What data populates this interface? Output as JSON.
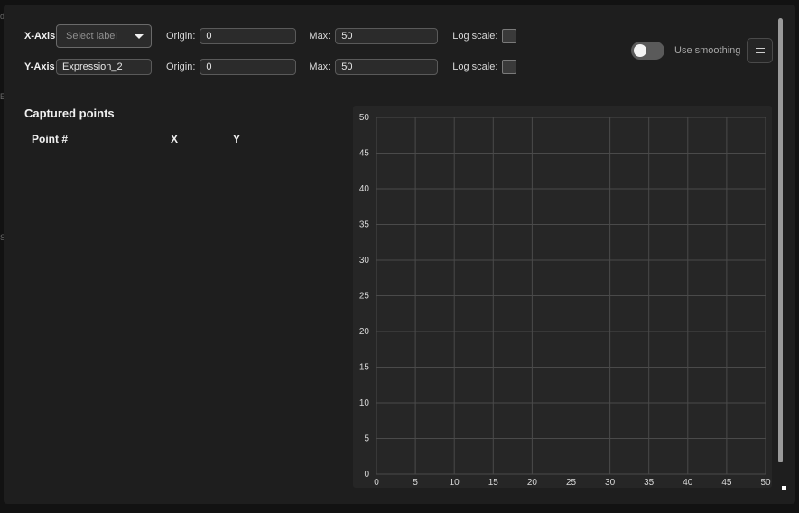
{
  "x_axis": {
    "label": "X-Axis",
    "select_placeholder": "Select label",
    "origin_label": "Origin:",
    "origin_value": "0",
    "max_label": "Max:",
    "max_value": "50",
    "log_label": "Log scale:",
    "log_checked": false
  },
  "y_axis": {
    "label": "Y-Axis",
    "name_value": "Expression_2",
    "origin_label": "Origin:",
    "origin_value": "0",
    "max_label": "Max:",
    "max_value": "50",
    "log_label": "Log scale:",
    "log_checked": false
  },
  "smoothing": {
    "label": "Use smoothing",
    "enabled": false
  },
  "captured": {
    "title": "Captured points",
    "columns": [
      "Point #",
      "X",
      "Y"
    ],
    "rows": []
  },
  "chart_data": {
    "type": "scatter",
    "series": [],
    "xlim": [
      0,
      50
    ],
    "ylim": [
      0,
      50
    ],
    "x_ticks": [
      0,
      5,
      10,
      15,
      20,
      25,
      30,
      35,
      40,
      45,
      50
    ],
    "y_ticks": [
      0,
      5,
      10,
      15,
      20,
      25,
      30,
      35,
      40,
      45,
      50
    ],
    "grid": true,
    "colors": {
      "grid": "#4a4a4a",
      "tick_label": "#d8d8d8",
      "background": "#262626"
    }
  }
}
